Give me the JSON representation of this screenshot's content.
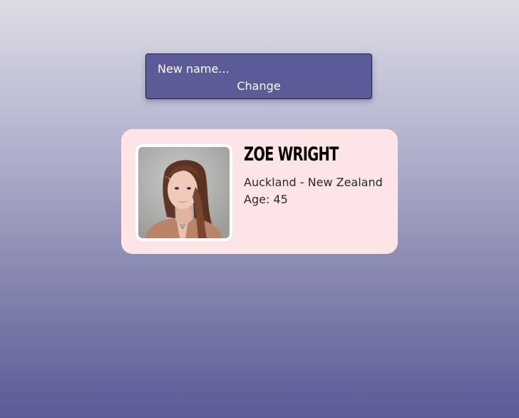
{
  "form": {
    "input_placeholder": "New name...",
    "input_value": "",
    "button_label": "Change"
  },
  "profile": {
    "name": "Zoe Wright",
    "location": "Auckland - New Zealand",
    "age": "Age: 45",
    "avatar_icon": "portrait-photo"
  },
  "colors": {
    "form_background": "#5c5b99",
    "card_background": "#fde4e6",
    "text_white": "#ffffff"
  }
}
